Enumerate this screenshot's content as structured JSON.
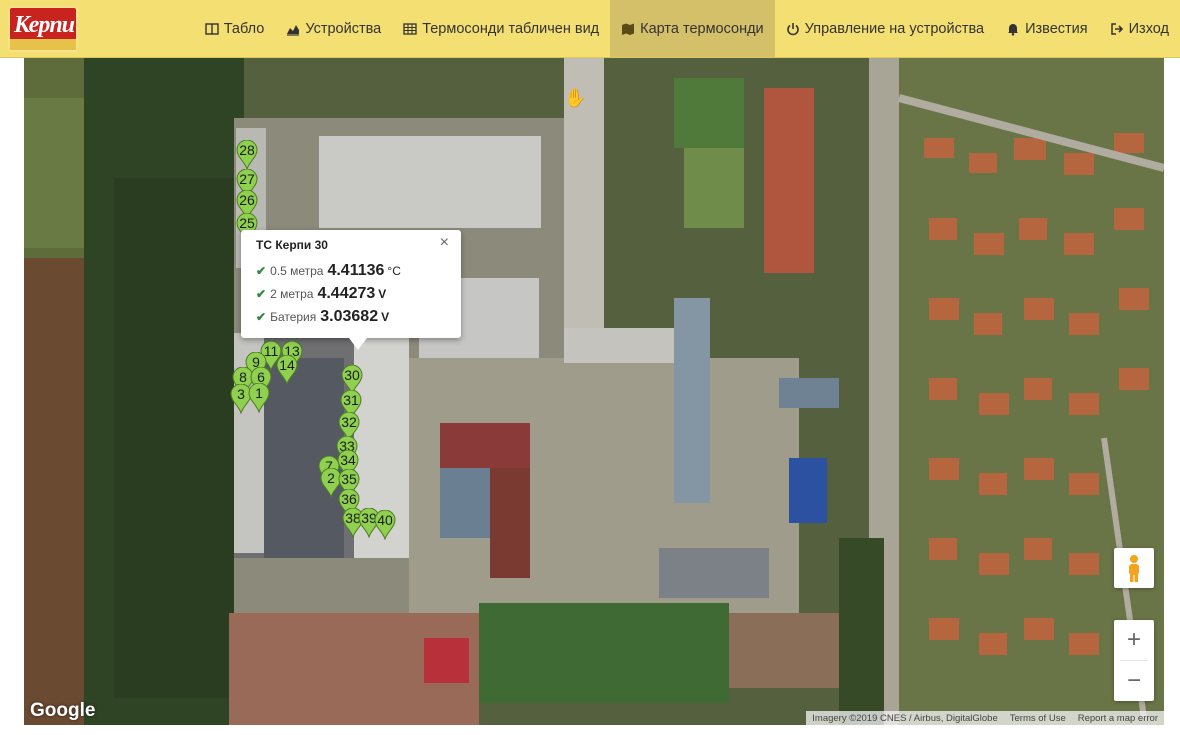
{
  "nav": {
    "logo_text": "Керпи",
    "items": [
      {
        "label": "Табло",
        "icon": "columns-icon",
        "active": false
      },
      {
        "label": "Устройства",
        "icon": "area-chart-icon",
        "active": false
      },
      {
        "label": "Термосонди табличен вид",
        "icon": "table-icon",
        "active": false
      },
      {
        "label": "Карта термосонди",
        "icon": "map-icon",
        "active": true
      },
      {
        "label": "Управление на устройства",
        "icon": "power-icon",
        "active": false
      },
      {
        "label": "Известия",
        "icon": "bell-icon",
        "active": false
      },
      {
        "label": "Изход",
        "icon": "sign-out-icon",
        "active": false
      }
    ]
  },
  "map": {
    "markers": [
      "28",
      "27",
      "26",
      "25",
      "11",
      "13",
      "14",
      "9",
      "8",
      "6",
      "3",
      "1",
      "30",
      "31",
      "32",
      "33",
      "7",
      "34",
      "2",
      "35",
      "36",
      "38",
      "39",
      "40"
    ],
    "popup": {
      "title": "ТС Керпи 30",
      "close": "×",
      "rows": [
        {
          "label": "0.5 метра",
          "value": "4.41136",
          "unit": "°C"
        },
        {
          "label": "2 метра",
          "value": "4.44273",
          "unit": "V"
        },
        {
          "label": "Батерия",
          "value": "3.03682",
          "unit": "V"
        }
      ]
    },
    "controls": {
      "zoom_in": "+",
      "zoom_out": "−"
    },
    "logo": "Google",
    "credits": {
      "imagery": "Imagery ©2019 CNES / Airbus, DigitalGlobe",
      "terms": "Terms of Use",
      "report": "Report a map error"
    },
    "colors": {
      "marker": "#8fd14f",
      "nav": "#f4df72",
      "active_nav": "#d5c06a"
    }
  }
}
